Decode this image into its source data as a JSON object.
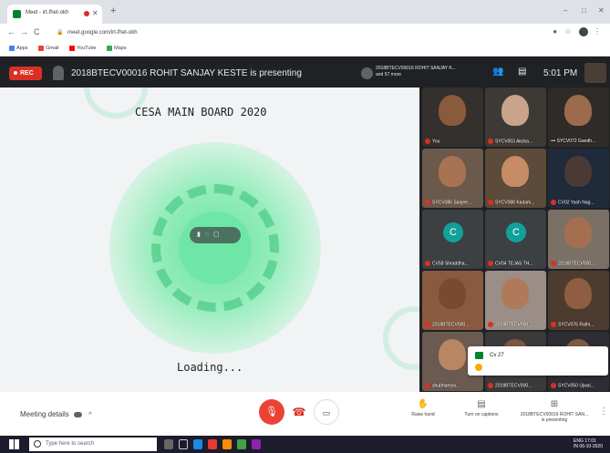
{
  "browser": {
    "tab_title": "Meet - irt-fhet-okh",
    "new_tab": "+",
    "window_controls": [
      "–",
      "□",
      "✕"
    ],
    "url": "meet.google.com/irt-fhet-okh",
    "back": "←",
    "forward": "→",
    "reload": "C",
    "bookmarks": [
      {
        "label": "Apps",
        "color": "#4285f4"
      },
      {
        "label": "Gmail",
        "color": "#ea4335"
      },
      {
        "label": "YouTube",
        "color": "#ff0000"
      },
      {
        "label": "Maps",
        "color": "#34a853"
      }
    ]
  },
  "meet_bar": {
    "rec_label": "REC",
    "presenting_text": "2018BTECV00016 ROHIT SANJAY KESTE is presenting",
    "pinned_name": "2018BTECV00016 ROHIT SANJAY K...",
    "pinned_sub": "and 57 more",
    "time": "5:01 PM"
  },
  "stage": {
    "title": "CESA MAIN BOARD 2020",
    "loading": "Loading..."
  },
  "participants": [
    {
      "name": "You",
      "muted": true,
      "type": "video",
      "bg": "#33302d",
      "skin": "#8a5a3c"
    },
    {
      "name": "SYCV003 Aksha...",
      "muted": true,
      "type": "video",
      "bg": "#3d3a36",
      "skin": "#c9a48a"
    },
    {
      "name": "SYCV072 Gandh...",
      "muted": false,
      "type": "video",
      "bg": "#2f2b29",
      "skin": "#9c6b4e"
    },
    {
      "name": "SYCV086 Sanjee...",
      "muted": true,
      "type": "video",
      "bg": "#6b5a4c",
      "skin": "#a77352"
    },
    {
      "name": "SYCV088 Kadam...",
      "muted": true,
      "type": "video",
      "bg": "#5c4a3a",
      "skin": "#c58c66"
    },
    {
      "name": "CV02 Yash Nag...",
      "muted": true,
      "type": "video",
      "bg": "#1f2a3a",
      "skin": "#4a3a35"
    },
    {
      "name": "CV58 Shraddha...",
      "muted": true,
      "type": "initial",
      "initial": "C",
      "bg": "#3c4043"
    },
    {
      "name": "CV04 TEJAS TH...",
      "muted": true,
      "type": "initial",
      "initial": "C",
      "bg": "#3c4043"
    },
    {
      "name": "2018BTECV000...",
      "muted": true,
      "type": "video",
      "bg": "#7a7066",
      "skin": "#a56f4f"
    },
    {
      "name": "2018BTECV000...",
      "muted": true,
      "type": "video",
      "bg": "#8a5a40",
      "skin": "#7a4a30"
    },
    {
      "name": "2018BTECV000...",
      "muted": true,
      "type": "video",
      "bg": "#9a8e86",
      "skin": "#b07a5a"
    },
    {
      "name": "SYCV076 Rathi...",
      "muted": true,
      "type": "video",
      "bg": "#4d3b30",
      "skin": "#8e5d42"
    },
    {
      "name": "shubhamya...",
      "muted": true,
      "type": "video",
      "bg": "#6a5a50",
      "skin": "#b98664"
    },
    {
      "name": "2018BTECV000...",
      "muted": true,
      "type": "video",
      "bg": "#3a3a3a",
      "skin": "#7d5742"
    },
    {
      "name": "SYCV050 Ujwal...",
      "muted": true,
      "type": "video",
      "bg": "#2d2d33",
      "skin": "#7d5a44"
    }
  ],
  "chat_popup": {
    "name": "Cv 27"
  },
  "bottom_bar": {
    "meeting_details": "Meeting details",
    "raise_hand": "Raise hand",
    "captions": "Turn on captions",
    "presenting": "2018BTECV00016 ROHIT SAN...",
    "presenting_sub": "is presenting"
  },
  "taskbar": {
    "search_placeholder": "Type here to search",
    "systray_top": "ENG  17:01",
    "systray_bottom": "IN    06-10-2020"
  },
  "colors": {
    "rec": "#d93025",
    "mic_off": "#ea4335",
    "accent_green": "#00832d"
  }
}
